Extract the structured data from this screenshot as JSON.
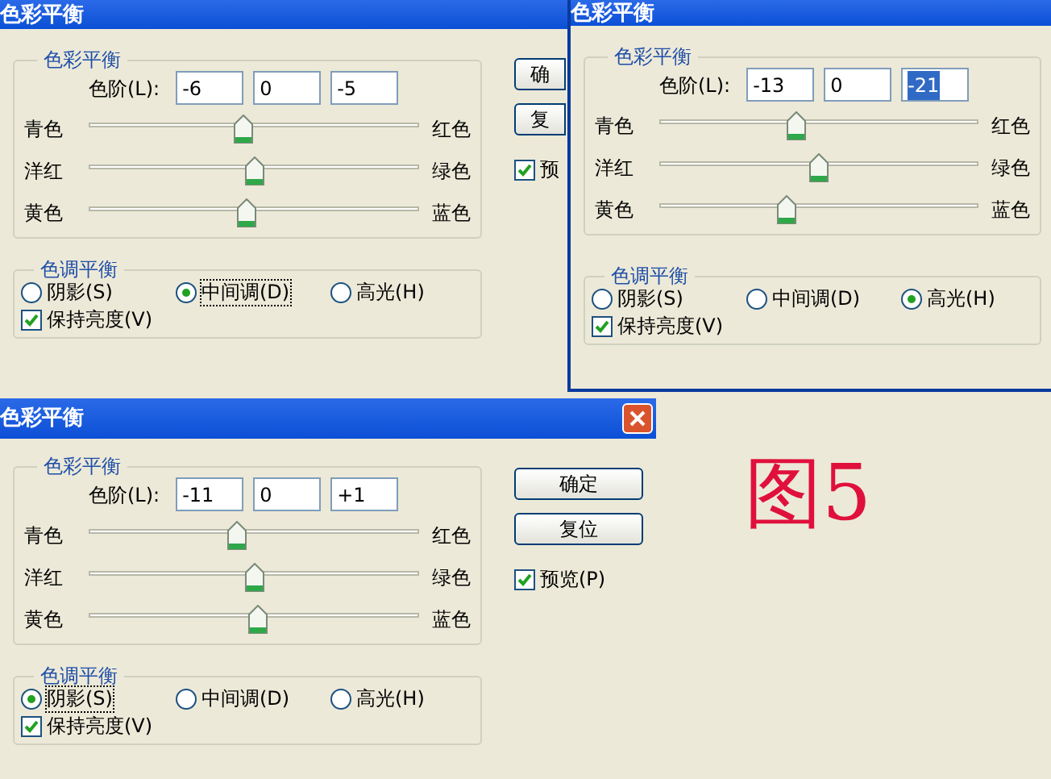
{
  "dialogs": [
    {
      "title": "色彩平衡",
      "close_button": false,
      "color_group": "色彩平衡",
      "levels_label": "色阶(L):",
      "levels": [
        {
          "value": "-6",
          "selected": false
        },
        {
          "value": "0",
          "selected": false
        },
        {
          "value": "-5",
          "selected": false
        }
      ],
      "sliders": [
        {
          "left": "青色",
          "right": "红色",
          "level": 0.47
        },
        {
          "left": "洋红",
          "right": "绿色",
          "level": 0.5
        },
        {
          "left": "黄色",
          "right": "蓝色",
          "level": 0.48
        }
      ],
      "tone_group": "色调平衡",
      "tones": [
        {
          "label": "阴影(S)",
          "selected": false,
          "focused": false
        },
        {
          "label": "中间调(D)",
          "selected": true,
          "focused": true
        },
        {
          "label": "高光(H)",
          "selected": false,
          "focused": false
        }
      ],
      "preserve": {
        "label": "保持亮度(V)",
        "checked": true
      },
      "buttons": [
        "确",
        "复"
      ],
      "preview": {
        "label": "预",
        "checked": true
      }
    },
    {
      "title": "色彩平衡",
      "close_button": false,
      "color_group": "色彩平衡",
      "levels_label": "色阶(L):",
      "levels": [
        {
          "value": "-13",
          "selected": false
        },
        {
          "value": "0",
          "selected": false
        },
        {
          "value": "-21",
          "selected": true
        }
      ],
      "sliders": [
        {
          "left": "青色",
          "right": "红色",
          "level": 0.43
        },
        {
          "left": "洋红",
          "right": "绿色",
          "level": 0.5
        },
        {
          "left": "黄色",
          "right": "蓝色",
          "level": 0.4
        }
      ],
      "tone_group": "色调平衡",
      "tones": [
        {
          "label": "阴影(S)",
          "selected": false,
          "focused": false
        },
        {
          "label": "中间调(D)",
          "selected": false,
          "focused": false
        },
        {
          "label": "高光(H)",
          "selected": true,
          "focused": false
        }
      ],
      "preserve": {
        "label": "保持亮度(V)",
        "checked": true
      }
    },
    {
      "title": "色彩平衡",
      "close_button": true,
      "color_group": "色彩平衡",
      "levels_label": "色阶(L):",
      "levels": [
        {
          "value": "-11",
          "selected": false
        },
        {
          "value": "0",
          "selected": false
        },
        {
          "value": "+1",
          "selected": false
        }
      ],
      "sliders": [
        {
          "left": "青色",
          "right": "红色",
          "level": 0.45
        },
        {
          "left": "洋红",
          "right": "绿色",
          "level": 0.5
        },
        {
          "left": "黄色",
          "right": "蓝色",
          "level": 0.51
        }
      ],
      "tone_group": "色调平衡",
      "tones": [
        {
          "label": "阴影(S)",
          "selected": true,
          "focused": true
        },
        {
          "label": "中间调(D)",
          "selected": false,
          "focused": false
        },
        {
          "label": "高光(H)",
          "selected": false,
          "focused": false
        }
      ],
      "preserve": {
        "label": "保持亮度(V)",
        "checked": true
      },
      "buttons": [
        "确定",
        "复位"
      ],
      "preview": {
        "label": "预览(P)",
        "checked": true
      }
    }
  ],
  "caption": "图5"
}
